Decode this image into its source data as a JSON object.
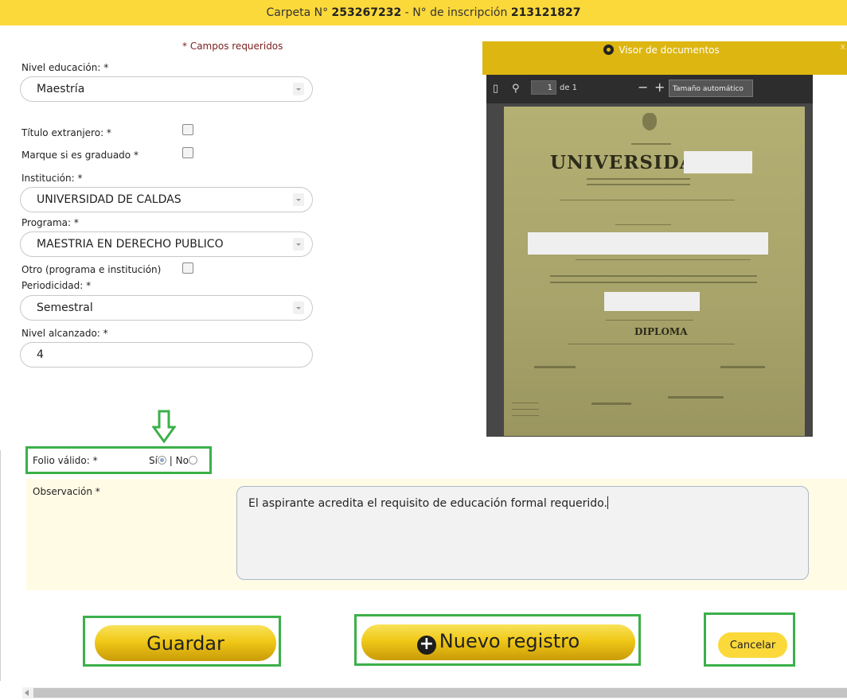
{
  "header": {
    "carpeta_label": "Carpeta N°",
    "carpeta_number": "253267232",
    "separator": "-",
    "inscripcion_label": "N° de inscripción",
    "inscripcion_number": "213121827"
  },
  "form": {
    "required_note": "* Campos requeridos",
    "nivel_educacion": {
      "label": "Nivel educación: *",
      "value": "Maestría"
    },
    "titulo_extranjero": {
      "label": "Título extranjero: *",
      "checked": false
    },
    "graduado": {
      "label": "Marque si es graduado *",
      "checked": false
    },
    "institucion": {
      "label": "Institución: *",
      "value": "UNIVERSIDAD DE CALDAS"
    },
    "programa": {
      "label": "Programa: *",
      "value": "MAESTRIA EN DERECHO PUBLICO"
    },
    "otro": {
      "label": "Otro (programa e institución)",
      "checked": false
    },
    "periodicidad": {
      "label": "Periodicidad: *",
      "value": "Semestral"
    },
    "nivel_alcanzado": {
      "label": "Nivel alcanzado: *",
      "value": "4"
    }
  },
  "viewer": {
    "title": "Visor de documentos",
    "close": "x",
    "page_current": "1",
    "page_of": "de 1",
    "zoom": "Tamaño automático",
    "doc_heading": "UNIVERSIDAD DE",
    "doc_diploma": "DIPLOMA"
  },
  "folio": {
    "label": "Folio válido: *",
    "yes": "Sí",
    "sep": "|",
    "no": "No",
    "selected": "yes"
  },
  "observacion": {
    "label": "Observación *",
    "value": "El aspirante acredita el requisito de educación formal requerido."
  },
  "buttons": {
    "save": "Guardar",
    "new": "Nuevo registro",
    "cancel": "Cancelar"
  },
  "colors": {
    "accent": "#fcd93a",
    "highlight": "#3cb04a",
    "viewer_header": "#ddb611"
  }
}
